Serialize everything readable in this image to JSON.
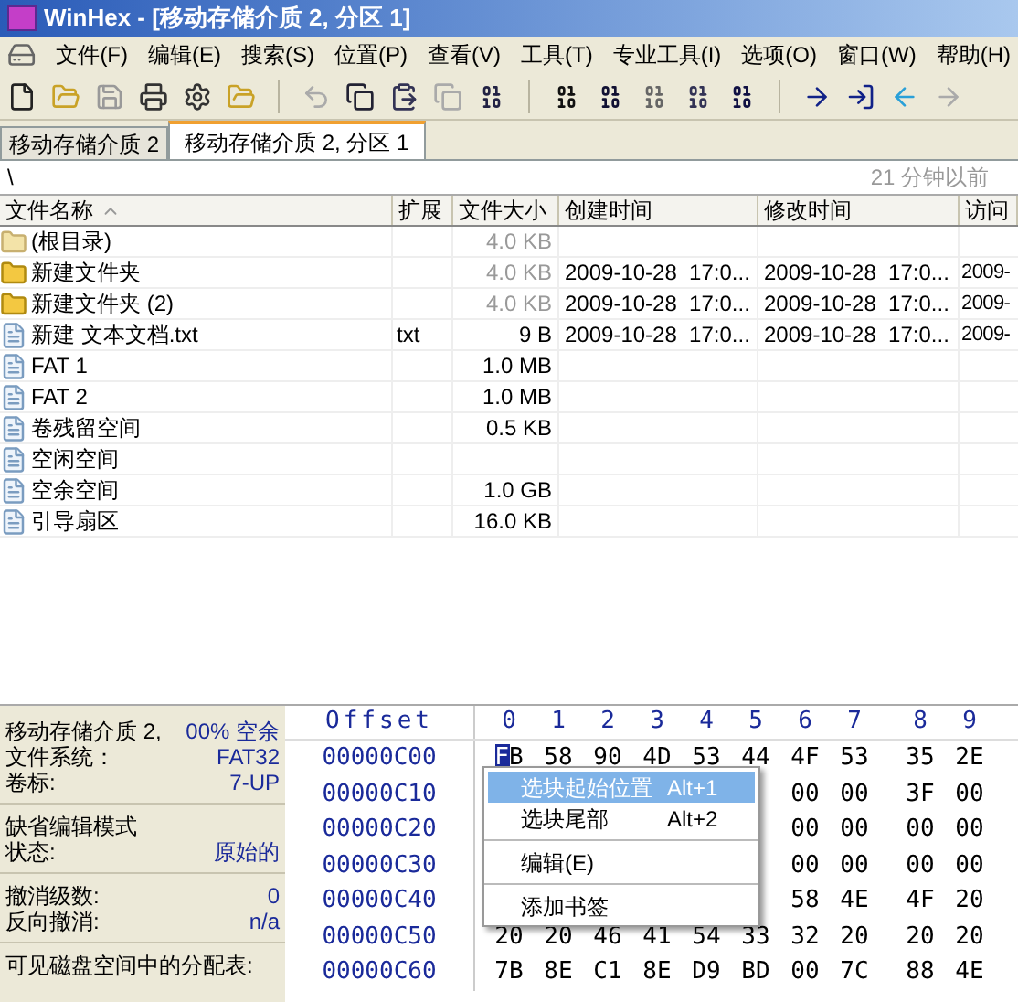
{
  "window": {
    "title": "WinHex - [移动存储介质 2, 分区 1]"
  },
  "menu": [
    "文件(F)",
    "编辑(E)",
    "搜索(S)",
    "位置(P)",
    "查看(V)",
    "工具(T)",
    "专业工具(I)",
    "选项(O)",
    "窗口(W)",
    "帮助(H)"
  ],
  "tabs": [
    {
      "label": "移动存储介质 2",
      "selected": false
    },
    {
      "label": "移动存储介质 2, 分区 1",
      "selected": true
    }
  ],
  "path": {
    "text": "\\",
    "age": "21 分钟以前"
  },
  "table": {
    "columns": [
      "文件名称",
      "扩展",
      "文件大小",
      "创建时间",
      "修改时间",
      "访问"
    ],
    "rows": [
      {
        "kind": "root",
        "name": "(根目录)",
        "size": "4.0 KB",
        "dim": true
      },
      {
        "kind": "folder",
        "name": "新建文件夹",
        "size": "4.0 KB",
        "dim": true,
        "created": "2009-10-28  17:0...",
        "modified": "2009-10-28  17:0...",
        "accessed": "2009-"
      },
      {
        "kind": "folder",
        "name": "新建文件夹 (2)",
        "size": "4.0 KB",
        "dim": true,
        "created": "2009-10-28  17:0...",
        "modified": "2009-10-28  17:0...",
        "accessed": "2009-"
      },
      {
        "kind": "file",
        "name": "新建 文本文档.txt",
        "ext": "txt",
        "size": "9 B",
        "dim": false,
        "created": "2009-10-28  17:0...",
        "modified": "2009-10-28  17:0...",
        "accessed": "2009-"
      },
      {
        "kind": "file",
        "name": "FAT 1",
        "size": "1.0 MB",
        "dim": false
      },
      {
        "kind": "file",
        "name": "FAT 2",
        "size": "1.0 MB",
        "dim": false
      },
      {
        "kind": "file",
        "name": "卷残留空间",
        "size": "0.5 KB",
        "dim": false
      },
      {
        "kind": "file",
        "name": "空闲空间"
      },
      {
        "kind": "file",
        "name": "空余空间",
        "size": "1.0 GB",
        "dim": false
      },
      {
        "kind": "file",
        "name": "引导扇区",
        "size": "16.0 KB",
        "dim": false
      }
    ]
  },
  "info_panel": [
    [
      {
        "label": "移动存储介质 2,",
        "value": "00% 空余"
      },
      {
        "label": "文件系统：",
        "value": "FAT32"
      },
      {
        "label": "卷标:",
        "value": "7-UP"
      }
    ],
    [
      {
        "label": "缺省编辑模式"
      },
      {
        "label": "状态:",
        "value": "原始的"
      }
    ],
    [
      {
        "label": "撤消级数:",
        "value": "0"
      },
      {
        "label": "反向撤消:",
        "value": "n/a"
      }
    ],
    [
      {
        "label": "可见磁盘空间中的分配表:"
      }
    ]
  ],
  "hex": {
    "offset_heading": "Offset",
    "columns": [
      "0",
      "1",
      "2",
      "3",
      "4",
      "5",
      "6",
      "7",
      "8",
      "9"
    ],
    "rows": [
      {
        "offset": "00000C00",
        "cursor": true,
        "cells": [
          "FB",
          "58",
          "90",
          "4D",
          "53",
          "44",
          "4F",
          "53",
          "35",
          "2E"
        ]
      },
      {
        "offset": "00000C10",
        "cursor": false,
        "cells": [
          "00",
          "00",
          "3F",
          "00"
        ]
      },
      {
        "offset": "00000C20",
        "cursor": false,
        "cells": [
          "00",
          "00",
          "00",
          "00"
        ]
      },
      {
        "offset": "00000C30",
        "cursor": false,
        "cells": [
          "00",
          "00",
          "00",
          "00"
        ]
      },
      {
        "offset": "00000C40",
        "cursor": false,
        "cells": [
          "58",
          "4E",
          "4F",
          "20"
        ]
      },
      {
        "offset": "00000C50",
        "cursor": false,
        "cells": [
          "20",
          "20",
          "46",
          "41",
          "54",
          "33",
          "32",
          "20",
          "20",
          "20"
        ]
      },
      {
        "offset": "00000C60",
        "cursor": false,
        "cells": [
          "7B",
          "8E",
          "C1",
          "8E",
          "D9",
          "BD",
          "00",
          "7C",
          "88",
          "4E"
        ]
      }
    ]
  },
  "context_menu": [
    {
      "kind": "item",
      "label": "选块起始位置",
      "shortcut": "Alt+1",
      "selected": true
    },
    {
      "kind": "item",
      "label": "选块尾部",
      "shortcut": "Alt+2",
      "selected": false
    },
    {
      "kind": "separator"
    },
    {
      "kind": "item",
      "label": "编辑(E)",
      "selected": false
    },
    {
      "kind": "separator"
    },
    {
      "kind": "item",
      "label": "添加书签",
      "selected": false
    }
  ]
}
